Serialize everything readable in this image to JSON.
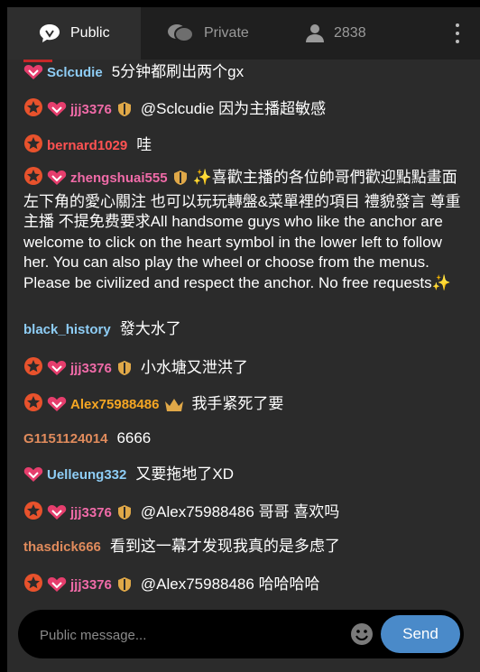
{
  "tabs": [
    {
      "label": "Public",
      "icon": "chat-bubble-icon",
      "active": true
    },
    {
      "label": "Private",
      "icon": "private-chat-icon",
      "active": false
    },
    {
      "label": "2838",
      "icon": "user-icon",
      "active": false
    }
  ],
  "messages": [
    {
      "user": "Sclcudie",
      "text": "5分钟都刷出两个gx"
    },
    {
      "user": "jjj3376",
      "text": "@Sclcudie  因为主播超敏感"
    },
    {
      "user": "bernard1029",
      "text": "哇"
    },
    {
      "user": "zhengshuai555",
      "text": "✨喜歡主播的各位帥哥們歡迎點點畫面左下角的愛心關注 也可以玩玩轉盤&菜單裡的項目 禮貌發言 尊重主播 不提免费要求All handsome guys who like the anchor are welcome to click on the heart symbol in the lower left to follow her. You can also play the wheel or choose from the menus. Please be civilized and respect the anchor. No free requests✨"
    },
    {
      "user": "black_history",
      "text": "發大水了"
    },
    {
      "user": "jjj3376",
      "text": "小水塘又泄洪了"
    },
    {
      "user": "Alex75988486",
      "text": "我手紧死了要"
    },
    {
      "user": "G1151124014",
      "text": "6666"
    },
    {
      "user": "Uelleung332",
      "text": "又要拖地了XD"
    },
    {
      "user": "jjj3376",
      "text": "@Alex75988486  哥哥 喜欢吗"
    },
    {
      "user": "thasdick666",
      "text": "看到这一幕才发现我真的是多虑了"
    },
    {
      "user": "jjj3376",
      "text": "@Alex75988486  哈哈哈哈"
    }
  ],
  "composer": {
    "placeholder": "Public message...",
    "send_label": "Send"
  },
  "colors": {
    "header_bg": "#1f1f1f",
    "chat_bg": "#2b2b2b",
    "send_button": "#4a8ac9",
    "fan_badge": "#e63e6d",
    "level_badge": "#e8522c"
  }
}
